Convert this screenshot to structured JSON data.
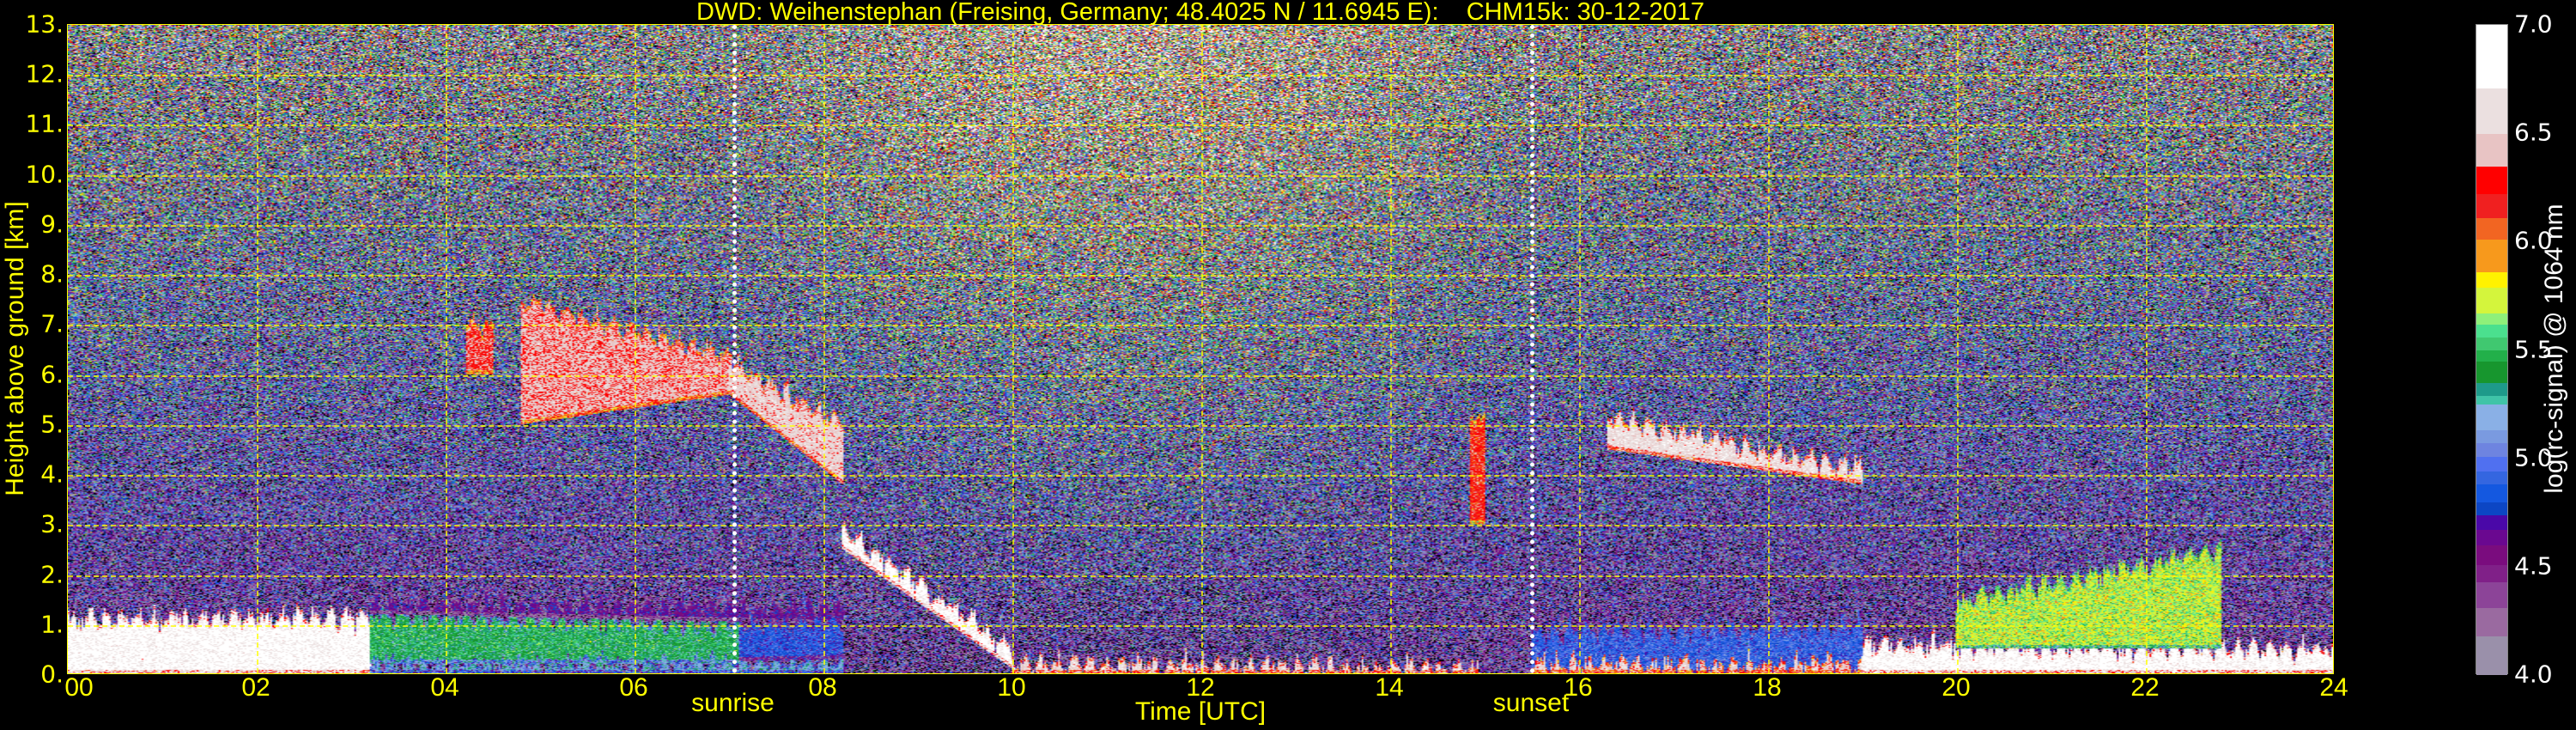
{
  "chart_data": {
    "type": "heatmap",
    "title": "DWD: Weihenstephan (Freising, Germany; 48.4025 N / 11.6945 E):    CHM15k: 30-12-2017",
    "xlabel": "Time [UTC]",
    "ylabel": "Height above ground [km]",
    "xlim": [
      0,
      24
    ],
    "ylim": [
      0,
      13
    ],
    "x_ticks": [
      "00",
      "02",
      "04",
      "06",
      "08",
      "10",
      "12",
      "14",
      "16",
      "18",
      "20",
      "22",
      "24"
    ],
    "x_tick_values": [
      0,
      2,
      4,
      6,
      8,
      10,
      12,
      14,
      16,
      18,
      20,
      22,
      24
    ],
    "y_ticks": [
      "0.",
      "1.",
      "2.",
      "3.",
      "4.",
      "5.",
      "6.",
      "7.",
      "8.",
      "9.",
      "10.",
      "11.",
      "12.",
      "13."
    ],
    "y_tick_values": [
      0,
      1,
      2,
      3,
      4,
      5,
      6,
      7,
      8,
      9,
      10,
      11,
      12,
      13
    ],
    "grid": true,
    "annotations": [
      {
        "label": "sunrise",
        "time_utc": 7.05
      },
      {
        "label": "sunset",
        "time_utc": 15.5
      }
    ],
    "colorbar": {
      "label": "log(rc-signal) @ 1064 nm",
      "range": [
        4.0,
        7.0
      ],
      "ticks": [
        "4.0",
        "4.5",
        "5.0",
        "5.5",
        "6.0",
        "6.5",
        "7.0"
      ],
      "tick_values": [
        4.0,
        4.5,
        5.0,
        5.5,
        6.0,
        6.5,
        7.0
      ],
      "segments": [
        {
          "from": 4.0,
          "color": "#9a90aa"
        },
        {
          "from": 4.18,
          "color": "#9a6aa0"
        },
        {
          "from": 4.31,
          "color": "#8c4498"
        },
        {
          "from": 4.43,
          "color": "#802088"
        },
        {
          "from": 4.51,
          "color": "#7a0c7e"
        },
        {
          "from": 4.6,
          "color": "#6a0890"
        },
        {
          "from": 4.67,
          "color": "#4a08a8"
        },
        {
          "from": 4.74,
          "color": "#0c46c4"
        },
        {
          "from": 4.8,
          "color": "#1458e0"
        },
        {
          "from": 4.88,
          "color": "#3466e0"
        },
        {
          "from": 4.94,
          "color": "#5070f0"
        },
        {
          "from": 5.01,
          "color": "#6e84e0"
        },
        {
          "from": 5.07,
          "color": "#7a9ae0"
        },
        {
          "from": 5.13,
          "color": "#8ab0e6"
        },
        {
          "from": 5.25,
          "color": "#40c4a8"
        },
        {
          "from": 5.29,
          "color": "#1e9a8a"
        },
        {
          "from": 5.35,
          "color": "#17962e"
        },
        {
          "from": 5.45,
          "color": "#22b04a"
        },
        {
          "from": 5.5,
          "color": "#40c870"
        },
        {
          "from": 5.56,
          "color": "#4be08e"
        },
        {
          "from": 5.62,
          "color": "#8ff07a"
        },
        {
          "from": 5.67,
          "color": "#d4f53c"
        },
        {
          "from": 5.79,
          "color": "#fff200"
        },
        {
          "from": 5.86,
          "color": "#f7991c"
        },
        {
          "from": 6.01,
          "color": "#f26522"
        },
        {
          "from": 6.11,
          "color": "#f02020"
        },
        {
          "from": 6.22,
          "color": "#ff0000"
        },
        {
          "from": 6.35,
          "color": "#e8c4c4"
        },
        {
          "from": 6.5,
          "color": "#ebe0e0"
        },
        {
          "from": 6.71,
          "color": "#ffffff"
        }
      ]
    },
    "features": [
      {
        "name": "nocturnal boundary layer",
        "t": [
          0,
          3.2
        ],
        "z_bottom": [
          0,
          0
        ],
        "z_top": [
          1.1,
          1.2
        ],
        "value": 6.8
      },
      {
        "name": "green mixed layer",
        "t": [
          3.2,
          7.1
        ],
        "z_bottom": [
          0.2,
          0.2
        ],
        "z_top": [
          1.2,
          1.0
        ],
        "value": 5.42
      },
      {
        "name": "low layer",
        "t": [
          3.2,
          8.2
        ],
        "z_bottom": [
          0,
          0
        ],
        "z_top": [
          0.2,
          0.25
        ],
        "value": 5.2
      },
      {
        "name": "residual layer",
        "t": [
          3.2,
          8.2
        ],
        "z_bottom": [
          1.2,
          1.0
        ],
        "z_top": [
          1.45,
          1.4
        ],
        "value": 4.62
      },
      {
        "name": "morning blue layer",
        "t": [
          7.1,
          8.2
        ],
        "z_bottom": [
          0.25,
          0.3
        ],
        "z_top": [
          1.0,
          1.1
        ],
        "value": 4.85
      },
      {
        "name": "cirrus",
        "t": [
          4.2,
          4.5
        ],
        "z_bottom": [
          6.0,
          6.0
        ],
        "z_top": [
          7.0,
          7.0
        ],
        "value": 6.3
      },
      {
        "name": "cirrus",
        "t": [
          4.8,
          7.0
        ],
        "z_bottom": [
          5.0,
          5.6
        ],
        "z_top": [
          7.5,
          6.4
        ],
        "value": 6.4
      },
      {
        "name": "cirrus",
        "t": [
          7.0,
          8.2
        ],
        "z_bottom": [
          5.6,
          3.8
        ],
        "z_top": [
          6.3,
          5.0
        ],
        "value": 6.5
      },
      {
        "name": "descending cloud",
        "t": [
          8.2,
          10.0
        ],
        "z_bottom": [
          2.5,
          0.1
        ],
        "z_top": [
          2.9,
          0.5
        ],
        "value": 6.8
      },
      {
        "name": "daytime surface layer",
        "t": [
          10.0,
          15.0
        ],
        "z_bottom": [
          0,
          0
        ],
        "z_top": [
          0.25,
          0.1
        ],
        "value": 6.6
      },
      {
        "name": "cloud",
        "t": [
          14.85,
          15.0
        ],
        "z_bottom": [
          3.0,
          3.0
        ],
        "z_top": [
          5.2,
          5.2
        ],
        "value": 6.2
      },
      {
        "name": "evening layer",
        "t": [
          15.5,
          19.0
        ],
        "z_bottom": [
          0,
          0
        ],
        "z_top": [
          0.9,
          1.0
        ],
        "value": 4.9
      },
      {
        "name": "evening surface",
        "t": [
          15.5,
          19.0
        ],
        "z_bottom": [
          0,
          0
        ],
        "z_top": [
          0.2,
          0.2
        ],
        "value": 6.5
      },
      {
        "name": "mid-level cloud",
        "t": [
          16.3,
          19.0
        ],
        "z_bottom": [
          4.5,
          3.8
        ],
        "z_top": [
          5.2,
          4.1
        ],
        "value": 6.6
      },
      {
        "name": "night surface layer",
        "t": [
          19.0,
          24.0
        ],
        "z_bottom": [
          0,
          0
        ],
        "z_top": [
          0.6,
          0.5
        ],
        "value": 6.8
      },
      {
        "name": "night plumes",
        "t": [
          20.0,
          22.8
        ],
        "z_bottom": [
          0.5,
          0.5
        ],
        "z_top": [
          1.5,
          2.5
        ],
        "value": 5.7
      }
    ]
  }
}
